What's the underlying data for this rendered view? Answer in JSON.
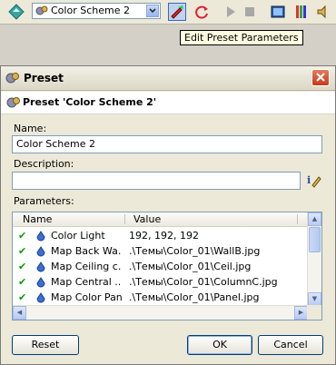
{
  "toolbar": {
    "preset_combo_value": "Color Scheme 2",
    "icons": [
      "preset-icon",
      "edit-preset-icon",
      "refresh-icon",
      "play-icon",
      "stop-icon",
      "render-icon",
      "palette-icon",
      "sound-icon"
    ]
  },
  "tooltip": {
    "text": "Edit Preset Parameters"
  },
  "dialog": {
    "title": "Preset",
    "header": "Preset 'Color Scheme 2'",
    "name_label": "Name:",
    "name_value": "Color Scheme 2",
    "description_label": "Description:",
    "description_value": "",
    "parameters_label": "Parameters:",
    "columns": {
      "name": "Name",
      "value": "Value"
    },
    "rows": [
      {
        "name": "Color Light",
        "value": "192, 192, 192"
      },
      {
        "name": "Map Back Wa...",
        "value": ".\\Темы\\Color_01\\WallB.jpg"
      },
      {
        "name": "Map Ceiling c...",
        "value": ".\\Темы\\Color_01\\Ceil.jpg"
      },
      {
        "name": "Map Central ...",
        "value": ".\\Темы\\Color_01\\ColumnC.jpg"
      },
      {
        "name": "Map Color Panel",
        "value": ".\\Темы\\Color_01\\Panel.jpg"
      }
    ],
    "buttons": {
      "reset": "Reset",
      "ok": "OK",
      "cancel": "Cancel"
    }
  },
  "colors": {
    "check": "#0a9a0a",
    "close": "#c53a18",
    "tooltip_bg": "#ffffe1"
  }
}
